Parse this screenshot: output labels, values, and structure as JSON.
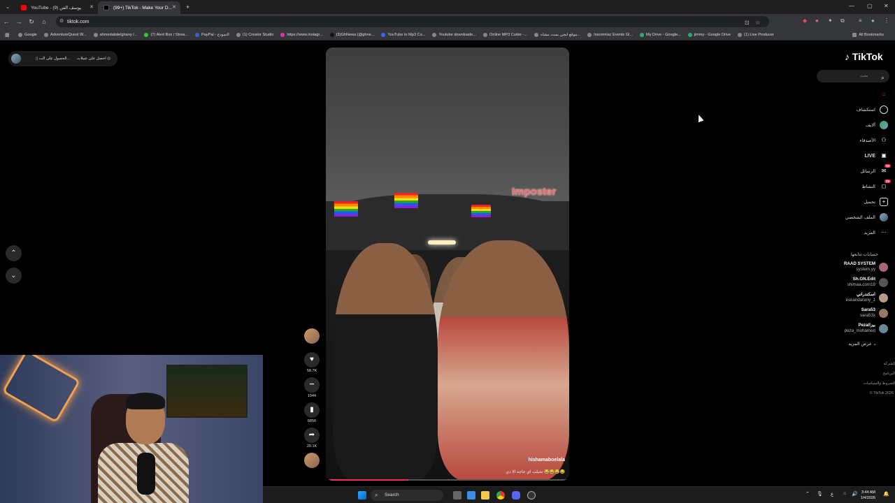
{
  "browser": {
    "tabs": [
      {
        "title": "YouTube - يوسف الفن (9)",
        "fav_color": "#ff0000"
      },
      {
        "title": "(99+) TikTok - Make Your D...",
        "fav_color": "#111111"
      }
    ],
    "url": "tiktok.com",
    "bookmarks": [
      "Google",
      "AdventureQuest W...",
      "ahmedabdelghany /...",
      "(7) Alert Box / Strea...",
      "PayPal - النموذج",
      "(1) Creator Studio",
      "https://www.instagr...",
      "(3)GhNewa (@ghne...",
      "YouTube to Mp3 Co...",
      "Youtube downloade...",
      "Online MP3 Cutter -...",
      "موقع ايجي بست مشاه...",
      "Insomniac Events Gl...",
      "My Drive - Google...",
      "jimmy - Google Drive",
      "(1) Live Producer"
    ],
    "all_bookmarks": "All Bookmarks"
  },
  "app_pill": {
    "get_coins": "احصل على عملات",
    "get_app": "الحصول على الت..."
  },
  "video": {
    "overlay_text": "Imposter",
    "author": "hishamaboelala",
    "caption": "تخيلت اي حاجه الا دي 😂😂😂😂",
    "progress": 0.34
  },
  "actions": [
    {
      "name": "like",
      "icon": "♥",
      "count": "58.7K"
    },
    {
      "name": "comment",
      "icon": "•••",
      "count": "1044"
    },
    {
      "name": "bookmark",
      "icon": "▮",
      "count": "6856"
    },
    {
      "name": "share",
      "icon": "➦",
      "count": "20.1K"
    }
  ],
  "sidebar": {
    "logo": "TikTok",
    "search_placeholder": "بحث",
    "items": [
      {
        "label": "",
        "icon": "⌂",
        "color": "#fe2c55"
      },
      {
        "label": "استكشاف",
        "icon": "◎",
        "color": "#ffffff"
      },
      {
        "label": "ألايف",
        "icon": "",
        "color": "#ffffff"
      },
      {
        "label": "الأصدقاء",
        "icon": "👥",
        "color": "#ffffff"
      },
      {
        "label": "LIVE",
        "icon": "▣",
        "color": "#ffffff"
      },
      {
        "label": "الرسائل",
        "icon": "✉",
        "color": "#ffffff",
        "badge": "99"
      },
      {
        "label": "النشاط",
        "icon": "◻",
        "color": "#ffffff",
        "badge": "99"
      },
      {
        "label": "تحميل",
        "icon": "+",
        "color": "#ffffff"
      },
      {
        "label": "الملف الشخصي",
        "icon": "",
        "color": "#ffffff"
      },
      {
        "label": "المزيد",
        "icon": "···",
        "color": "#ffffff"
      }
    ],
    "following_header": "حسابات تتابعها",
    "accounts": [
      {
        "name": "RAAD SYSTEM",
        "handle": "system.yy"
      },
      {
        "name": "Sh.GN.Edit",
        "handle": "shimaa.com18"
      },
      {
        "name": "اسكندراني",
        "handle": "eskandarany_1"
      },
      {
        "name": "Sara53",
        "handle": "sara53x"
      },
      {
        "name": "Peza/بيزا",
        "handle": "peza_mohamed"
      }
    ],
    "see_more": "عرض المزيد",
    "footer": [
      "الشركة",
      "البرنامج",
      "الشروط والسياسات",
      "© TikTok 2026"
    ]
  },
  "taskbar": {
    "search_label": "Search",
    "time": "3:44 AM",
    "date": "1/4/2026"
  }
}
